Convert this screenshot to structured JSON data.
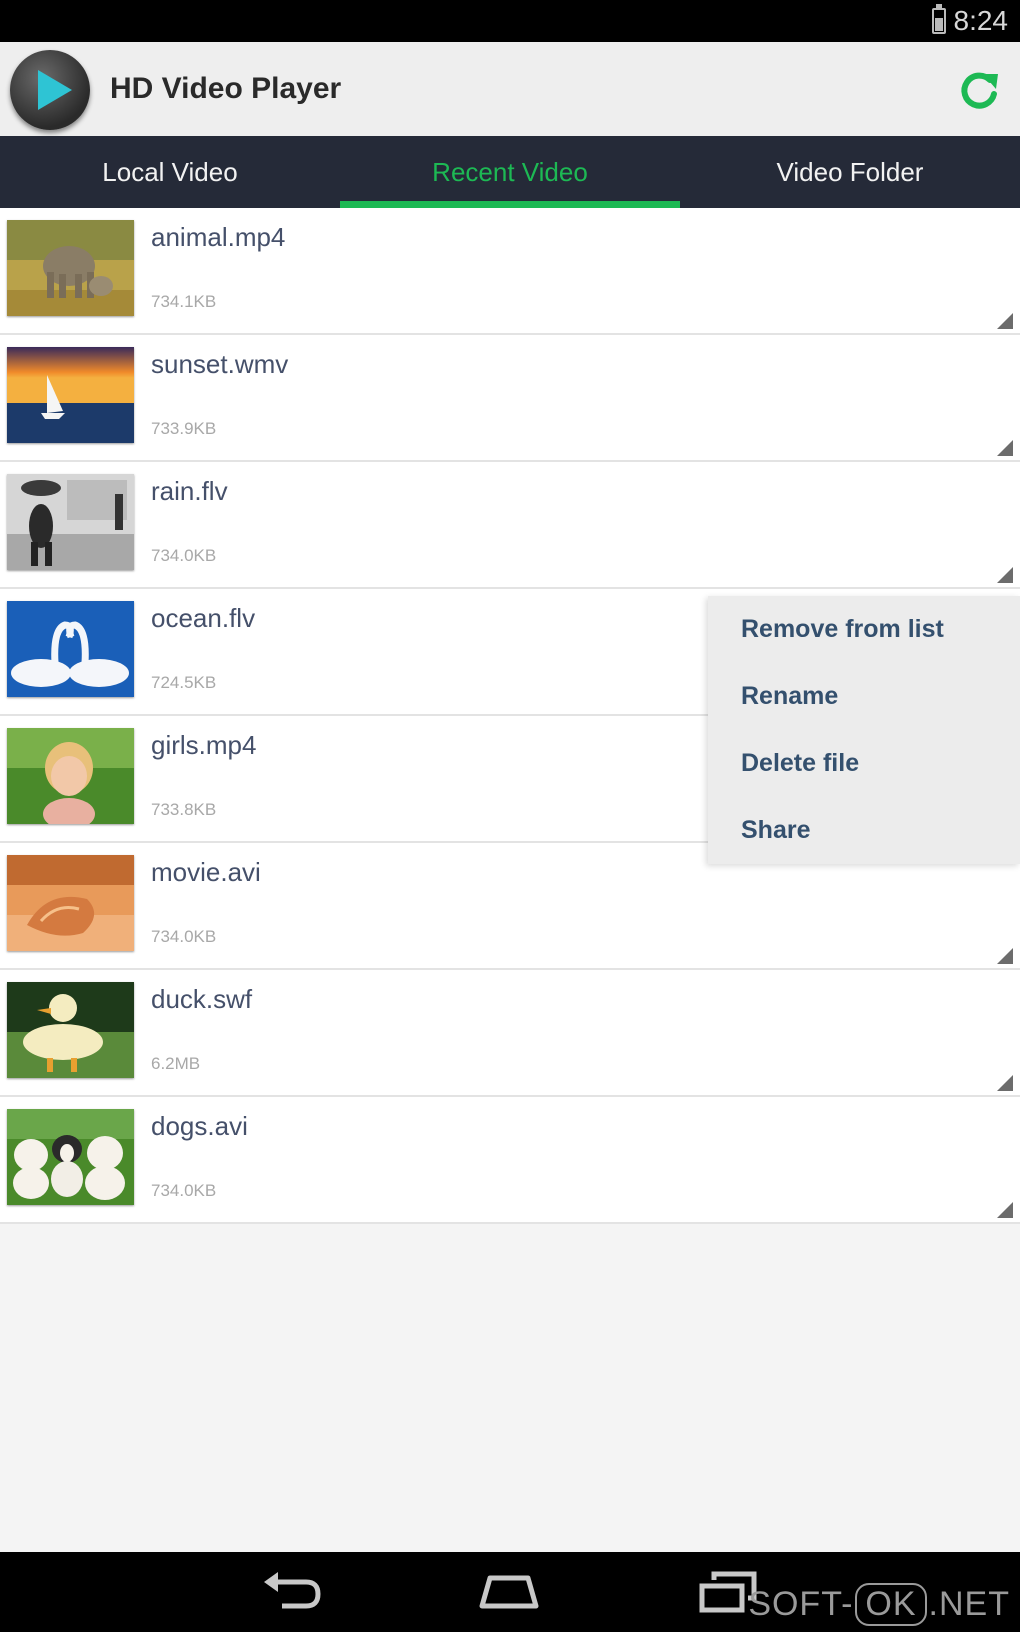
{
  "status_bar": {
    "time": "8:24"
  },
  "app_bar": {
    "title": "HD Video Player",
    "accent_color": "#1db954"
  },
  "tabs": [
    {
      "label": "Local Video",
      "active": false
    },
    {
      "label": "Recent Video",
      "active": true
    },
    {
      "label": "Video Folder",
      "active": false
    }
  ],
  "videos": [
    {
      "name": "animal.mp4",
      "size": "734.1KB"
    },
    {
      "name": "sunset.wmv",
      "size": "733.9KB"
    },
    {
      "name": "rain.flv",
      "size": "734.0KB"
    },
    {
      "name": "ocean.flv",
      "size": "724.5KB"
    },
    {
      "name": "girls.mp4",
      "size": "733.8KB"
    },
    {
      "name": "movie.avi",
      "size": "734.0KB"
    },
    {
      "name": "duck.swf",
      "size": "6.2MB"
    },
    {
      "name": "dogs.avi",
      "size": "734.0KB"
    }
  ],
  "context_menu": {
    "items": [
      "Remove from list",
      "Rename",
      "Delete file",
      "Share"
    ]
  },
  "watermark": {
    "left": "SOFT-",
    "mid": "OK",
    "right": ".NET"
  }
}
